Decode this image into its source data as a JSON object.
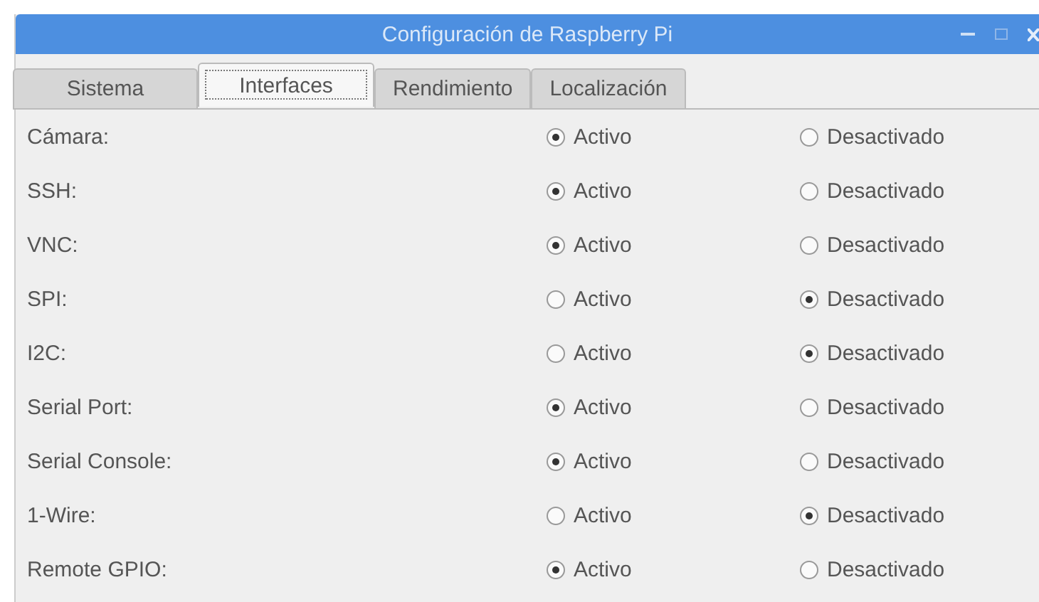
{
  "window": {
    "title": "Configuración de Raspberry Pi"
  },
  "tabs": [
    {
      "label": "Sistema",
      "selected": false
    },
    {
      "label": "Interfaces",
      "selected": true
    },
    {
      "label": "Rendimiento",
      "selected": false
    },
    {
      "label": "Localización",
      "selected": false
    }
  ],
  "rows": [
    {
      "label": "Cámara:",
      "options": [
        {
          "label": "Activo",
          "selected": true
        },
        {
          "label": "Desactivado",
          "selected": false
        }
      ]
    },
    {
      "label": "SSH:",
      "options": [
        {
          "label": "Activo",
          "selected": true
        },
        {
          "label": "Desactivado",
          "selected": false
        }
      ]
    },
    {
      "label": "VNC:",
      "options": [
        {
          "label": "Activo",
          "selected": true
        },
        {
          "label": "Desactivado",
          "selected": false
        }
      ]
    },
    {
      "label": "SPI:",
      "options": [
        {
          "label": "Activo",
          "selected": false
        },
        {
          "label": "Desactivado",
          "selected": true
        }
      ]
    },
    {
      "label": "I2C:",
      "options": [
        {
          "label": "Activo",
          "selected": false
        },
        {
          "label": "Desactivado",
          "selected": true
        }
      ]
    },
    {
      "label": "Serial Port:",
      "options": [
        {
          "label": "Activo",
          "selected": true
        },
        {
          "label": "Desactivado",
          "selected": false
        }
      ]
    },
    {
      "label": "Serial Console:",
      "options": [
        {
          "label": "Activo",
          "selected": true
        },
        {
          "label": "Desactivado",
          "selected": false
        }
      ]
    },
    {
      "label": "1-Wire:",
      "options": [
        {
          "label": "Activo",
          "selected": false
        },
        {
          "label": "Desactivado",
          "selected": true
        }
      ]
    },
    {
      "label": "Remote GPIO:",
      "options": [
        {
          "label": "Activo",
          "selected": true
        },
        {
          "label": "Desactivado",
          "selected": false
        }
      ]
    }
  ]
}
